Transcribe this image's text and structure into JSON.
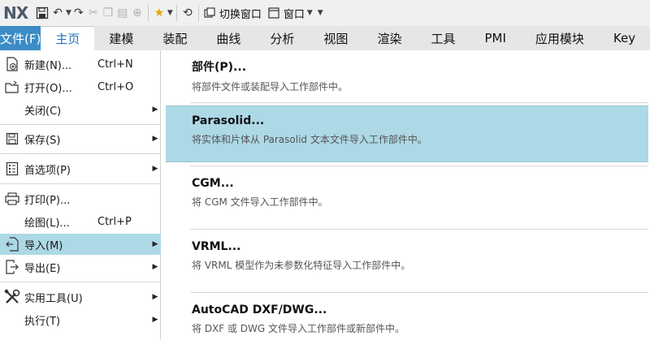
{
  "app": {
    "logo": "NX"
  },
  "quick_access": {
    "switch_window": "切换窗口",
    "window": "窗口"
  },
  "tabs": [
    "文件(F)",
    "主页",
    "建模",
    "装配",
    "曲线",
    "分析",
    "视图",
    "渲染",
    "工具",
    "PMI",
    "应用模块",
    "Key"
  ],
  "file_menu": [
    {
      "label": "新建(N)...",
      "shortcut": "Ctrl+N",
      "arrow": false,
      "icon": "new-file-icon"
    },
    {
      "label": "打开(O)...",
      "shortcut": "Ctrl+O",
      "arrow": false,
      "icon": "open-folder-icon"
    },
    {
      "label": "关闭(C)",
      "shortcut": "",
      "arrow": true,
      "icon": ""
    },
    {
      "label": "保存(S)",
      "shortcut": "",
      "arrow": true,
      "icon": "save-icon"
    },
    {
      "label": "首选项(P)",
      "shortcut": "",
      "arrow": true,
      "icon": "preferences-icon"
    },
    {
      "label": "打印(P)...",
      "shortcut": "",
      "arrow": false,
      "icon": "print-icon"
    },
    {
      "label": "绘图(L)...",
      "shortcut": "Ctrl+P",
      "arrow": false,
      "icon": ""
    },
    {
      "label": "导入(M)",
      "shortcut": "",
      "arrow": true,
      "icon": "import-icon"
    },
    {
      "label": "导出(E)",
      "shortcut": "",
      "arrow": true,
      "icon": "export-icon"
    },
    {
      "label": "实用工具(U)",
      "shortcut": "",
      "arrow": true,
      "icon": "utilities-icon"
    },
    {
      "label": "执行(T)",
      "shortcut": "",
      "arrow": true,
      "icon": ""
    }
  ],
  "import_submenu": [
    {
      "title": "部件(P)...",
      "desc": "将部件文件或装配导入工作部件中。"
    },
    {
      "title": "Parasolid...",
      "desc": "将实体和片体从 Parasolid 文本文件导入工作部件中。"
    },
    {
      "title": "CGM...",
      "desc": "将 CGM 文件导入工作部件中。"
    },
    {
      "title": "VRML...",
      "desc": "将 VRML 模型作为未参数化特征导入工作部件中。"
    },
    {
      "title": "AutoCAD DXF/DWG...",
      "desc": "将 DXF 或 DWG 文件导入工作部件或新部件中。"
    }
  ],
  "colors": {
    "file_tab": "#3b8cc6",
    "highlight": "#add8e6",
    "active_tab_text": "#2a72b8"
  }
}
